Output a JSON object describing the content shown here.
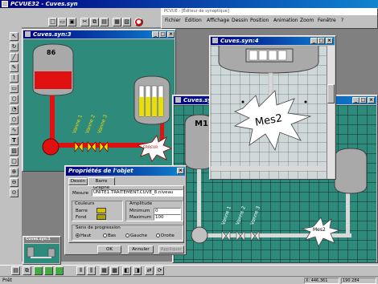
{
  "main_window": {
    "title": "PCVUE32 - Cuves.syn"
  },
  "editor_window": {
    "title": "PCVUE - [Éditeur de synoptique]",
    "menu": [
      "Fichier",
      "Édition",
      "Affichage",
      "Dessin",
      "Position",
      "Animation",
      "Zoom",
      "Fenêtre",
      "?"
    ]
  },
  "window_cuves3": {
    "title": "Cuves.syn:3",
    "tank_level": "86",
    "valves": [
      "Vanne 1",
      "Vanne 2",
      "Vanne 3"
    ],
    "burst_label": "ERREUR"
  },
  "window_cuves4": {
    "title": "Cuves.syn:4",
    "burst_label": "Mes2"
  },
  "window_cuves_back": {
    "title": "Cuves.syn:",
    "tank_label": "M1",
    "valves": [
      "Vanne 1",
      "Vanne 2",
      "Vanne 3"
    ],
    "burst_label": "Mes2"
  },
  "window_small": {
    "title": "Cuves.syn:1"
  },
  "dialog": {
    "title": "Propriétés de l'objet",
    "tabs": [
      "Dessin",
      "Barre Graphe"
    ],
    "active_tab": "Barre Graphe",
    "mesure_label": "Mesure",
    "mesure_value": "UNITE1.TRAITEMENT.CUVE_8.niveau",
    "couleurs_label": "Couleurs",
    "amplitude_label": "Amplitude",
    "barre_label": "Barre",
    "fond_label": "Fond",
    "minimum_label": "Minimum",
    "minimum_value": "0",
    "maximum_label": "Maximum",
    "maximum_value": "100",
    "progression_label": "Sens de progression",
    "directions": [
      "Haut",
      "Bas",
      "Gauche",
      "Droite"
    ],
    "selected_direction": "Haut",
    "ok_label": "OK",
    "cancel_label": "Annuler",
    "apply_label": "Appliquer",
    "colors": {
      "barre": "#d4c400",
      "fond": "#a8a000"
    }
  },
  "status": {
    "left": "Prêt",
    "coords": "X: 446,361",
    "size": "190 284"
  },
  "colors": {
    "teal": "#2e8b7c",
    "titlebar": "#000080",
    "pipe_red": "#e01010",
    "tank_gray": "#a9a9a9",
    "bar_yellow": "#e8e000"
  }
}
